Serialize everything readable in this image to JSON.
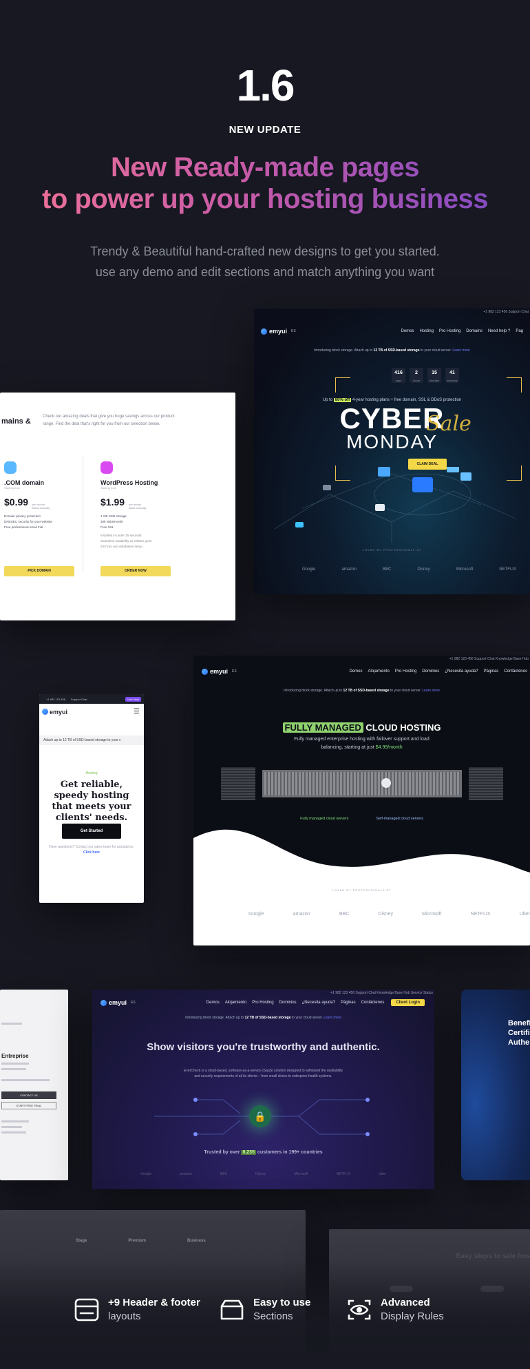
{
  "hero": {
    "version": "1.6",
    "update_label": "NEW UPDATE",
    "headline_line1": "New Ready-made pages",
    "headline_line2": "to power up your hosting business",
    "subtext_line1": "Trendy & Beautiful hand-crafted new designs to get you started.",
    "subtext_line2": "use any demo and edit sections and match anything you want"
  },
  "colors": {
    "background": "#171821",
    "headline_gradient_start": "#f17496",
    "headline_gradient_end": "#7b49c4",
    "accent_yellow": "#f5d847",
    "accent_green": "#8fd26e"
  },
  "cyber_demo": {
    "util": "+1 982 123 456   Support Chat",
    "logo": "emyui",
    "lang": "ES",
    "nav": [
      "Demos",
      "Hosting",
      "Pro Hosting",
      "Domains",
      "Need help ?",
      "Pag"
    ],
    "announce_pre": "Introducing block storage. Attach up to",
    "announce_bold": "12 TB of SSD-based storage",
    "announce_post": "to your cloud server.",
    "announce_link": "Learn more",
    "countdown": [
      {
        "value": "416",
        "label": "days"
      },
      {
        "value": "2",
        "label": "hours"
      },
      {
        "value": "15",
        "label": "minutes"
      },
      {
        "value": "41",
        "label": "seconds"
      }
    ],
    "offer_pre": "Up to",
    "offer_highlight": "80% off",
    "offer_post": "4-year hosting plans + free domain, SSL & DDoS protection",
    "title": "CYBER",
    "script": "Sale",
    "subtitle": "MONDAY",
    "cta": "CLAIM DEAL",
    "trusted": "LOVED BY PROFESSIONALS AT",
    "logos": [
      "Google",
      "amazon",
      "BBC",
      "Disney",
      "Microsoft",
      "NETFLIX"
    ]
  },
  "pricing": {
    "title": "mains &",
    "intro": "Check our amazing deals that give you huge savings across our product range. Find the deal that's right for you from our selection below.",
    "plans": [
      {
        "name": ".COM domain",
        "starting": "Starting from",
        "price": "$0.99",
        "per": "per month",
        "billed": "billed annually",
        "features": [
          "Domain privacy protection",
          "DNSSEC security for your website",
          "Free professional email trial"
        ],
        "button": "PICK DOMAIN",
        "icon_color": "#5ab8ff"
      },
      {
        "name": "WordPress Hosting",
        "starting": "Starting from",
        "price": "$1.99",
        "per": "per month",
        "billed": "billed annually",
        "features": [
          "1 GB SSD storage",
          "20k visits/month",
          "Free SSL",
          "Installed in under 25 seconds",
          "Seamless scalability as visitors grow",
          "24/7 pro and databases setup"
        ],
        "button": "ORDER NOW",
        "icon_color": "#d94af0"
      }
    ]
  },
  "mobile_demo": {
    "util_phone": "+1 982 123 456",
    "util_support": "Support Chat",
    "live": "Live Help",
    "logo": "emyui",
    "announce": "Attach up to 12 TB of SSD-based storage to your c",
    "tag": "Hosting",
    "headline": "Get reliable, speedy hosting that meets your clients' needs.",
    "cta": "Get Started",
    "question": "Have questions? Contact our sales team for assistance.",
    "question_link": "Click here"
  },
  "hosting_demo": {
    "util": "+1 982 123 456   Support Chat   Knowledge Base Hub",
    "logo": "emyui",
    "lang": "ES",
    "nav": [
      "Demos",
      "Alojamiento",
      "Pro Hosting",
      "Dominios",
      "¿Necesita ayuda?",
      "Páginas",
      "Contáctenos"
    ],
    "announce_pre": "Introducing block storage. Attach up to",
    "announce_bold": "12 TB of SSD-based storage",
    "announce_post": "to your cloud server.",
    "announce_link": "Learn more",
    "title_highlight": "FULLY MANAGED",
    "title_rest": "CLOUD HOSTING",
    "sub": "Fully managed enterprise hosting with failover support and load balancing, starting at just",
    "sub_price": "$4.99/month",
    "link_a": "Fully managed cloud servers",
    "link_b": "Self-managed cloud servers",
    "trusted": "LOVED BY PROFESSIONALS AT",
    "logos": [
      "Google",
      "amazon",
      "BBC",
      "Disney",
      "Microsoft",
      "NETFLIX",
      "Uber"
    ]
  },
  "trust_demo": {
    "util": "+1 982 123 456   Support Chat   Knowledge Base Hub   Service Status",
    "logo": "emyui",
    "lang": "ES",
    "nav": [
      "Demos",
      "Alojamiento",
      "Pro Hosting",
      "Dominios",
      "¿Necesita ayuda?",
      "Páginas",
      "Contáctenos"
    ],
    "login": "Client Login",
    "announce_pre": "Introducing block storage. Attach up to",
    "announce_bold": "12 TB of SSD-based storage",
    "announce_post": "to your cloud server.",
    "announce_link": "Learn more",
    "title": "Show visitors you're trustworthy and authentic.",
    "sub": "EverCheck is a cloud-based, software-as-a-service (SaaS) solution designed to withstand the availability and security requirements of all its clients – from small clinics to enterprise health systems.",
    "trusted_pre": "Trusted by over",
    "trusted_count": "8,235",
    "trusted_post": "customers in 199+ countries",
    "logos": [
      "Google",
      "amazon",
      "BBC",
      "Disney",
      "Microsoft",
      "NETFLIX",
      "Uber"
    ]
  },
  "side_left": {
    "title": "Entreprise",
    "button": "CONTACT US",
    "button2": "START FREE TRIAL"
  },
  "side_right": {
    "text": "Benefi Certifi Authe"
  },
  "bottom_left": {
    "cols": [
      "Stage",
      "Premium",
      "Business"
    ]
  },
  "bottom_right": {
    "title": "Easy steps to sale hos"
  },
  "features": [
    {
      "icon": "layout-icon",
      "title": "+9 Header & footer",
      "sub": "layouts"
    },
    {
      "icon": "box-icon",
      "title": "Easy to use",
      "sub": "Sections"
    },
    {
      "icon": "eye-scan-icon",
      "title": "Advanced",
      "sub": "Display Rules"
    }
  ]
}
